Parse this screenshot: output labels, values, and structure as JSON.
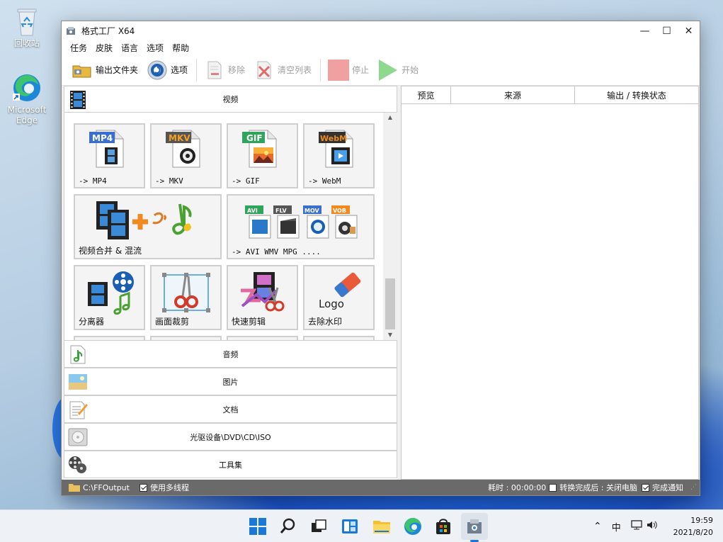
{
  "desktop": {
    "icons": [
      {
        "label": "回收站"
      },
      {
        "label": "Microsoft Edge"
      }
    ]
  },
  "window": {
    "title": "格式工厂 X64",
    "controls": {
      "minimize": "—",
      "maximize": "☐",
      "close": "✕"
    }
  },
  "menu": [
    "任务",
    "皮肤",
    "语言",
    "选项",
    "帮助"
  ],
  "toolbar": {
    "output_folder": "输出文件夹",
    "options": "选项",
    "remove": "移除",
    "clear_list": "清空列表",
    "stop": "停止",
    "start": "开始"
  },
  "categories": {
    "video": "视频",
    "audio": "音频",
    "picture": "图片",
    "document": "文档",
    "rom": "光驱设备\\DVD\\CD\\ISO",
    "tools": "工具集"
  },
  "video_tiles": [
    {
      "label": "-> MP4",
      "badge": "MP4",
      "badge_color": "#3a6fd0"
    },
    {
      "label": "-> MKV",
      "badge": "MKV",
      "badge_color": "#555555"
    },
    {
      "label": "-> GIF",
      "badge": "GIF",
      "badge_color": "#2fa45a"
    },
    {
      "label": "-> WebM",
      "badge": "WebM",
      "badge_color": "#e07820"
    },
    {
      "label": "视频合并 & 混流"
    },
    {
      "label": "-> AVI WMV MPG ....",
      "badges": [
        "AVI",
        "FLV",
        "MOV",
        "VOB"
      ]
    },
    {
      "label": "分离器"
    },
    {
      "label": "画面裁剪"
    },
    {
      "label": "快速剪辑"
    },
    {
      "label": "去除水印",
      "logo_text": "Logo"
    }
  ],
  "task_list": {
    "columns": [
      "预览",
      "来源",
      "输出 / 转换状态"
    ]
  },
  "status": {
    "output_path": "C:\\FFOutput",
    "multithread_label": "使用多线程",
    "multithread_checked": true,
    "elapsed": "耗时 : 00:00:00",
    "after_convert_label": "转换完成后 : 关闭电脑",
    "after_convert_checked": false,
    "notify_label": "完成通知",
    "notify_checked": true
  },
  "taskbar": {
    "ime": "中",
    "time": "19:59",
    "date": "2021/8/20"
  },
  "colors": {
    "accent_blue": "#1f63d6",
    "statusbar": "#6a6a6a",
    "stop_red": "#f0a0a0",
    "start_green": "#8fd88f"
  }
}
